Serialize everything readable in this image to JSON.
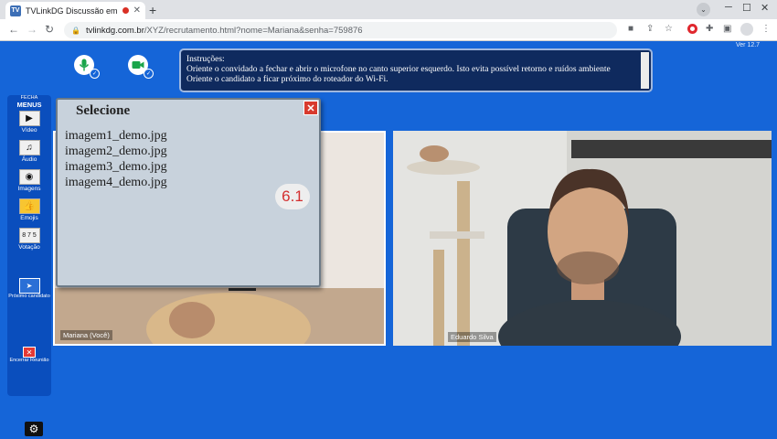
{
  "browser": {
    "tab_title": "TVLinkDG Discussão em Gru",
    "favicon_text": "TV",
    "url_host": "tvlinkdg.com.br",
    "url_path": "/XYZ/recrutamento.html?nome=Mariana&senha=759876"
  },
  "app": {
    "version": "Ver 12.7",
    "instructions_lines": [
      "Instruções:",
      "Oriente o convidado a fechar e abrir o microfone no canto superior esquerdo. Isto evita possível retorno e ruídos ambiente",
      "Oriente o candidato a ficar próximo do roteador do Wi-Fi."
    ]
  },
  "sidebar": {
    "header_small": "FECHA",
    "header_big": "MENUS",
    "items": [
      {
        "label": "Vídeo",
        "icon": "video-icon"
      },
      {
        "label": "Áudio",
        "icon": "audio-icon"
      },
      {
        "label": "Imagens",
        "icon": "image-icon"
      },
      {
        "label": "Emojis",
        "icon": "emoji-icon"
      },
      {
        "label": "Votação",
        "icon": "vote-icon"
      }
    ],
    "next_candidate": "Próximo candidato",
    "end_meeting": "Encerrar Reunião"
  },
  "dialog": {
    "title": "Selecione",
    "files": [
      "imagem1_demo.jpg",
      "imagem2_demo.jpg",
      "imagem3_demo.jpg",
      "imagem4_demo.jpg"
    ],
    "badge": "6.1"
  },
  "videos": {
    "left_name": "Mariana (Você)",
    "right_name": "Eduardo Silva"
  },
  "colors": {
    "background": "#1565d8",
    "sidebar": "#0a4ebd",
    "instructions_bg": "#0f2a5e",
    "close_red": "#d83a2e"
  }
}
